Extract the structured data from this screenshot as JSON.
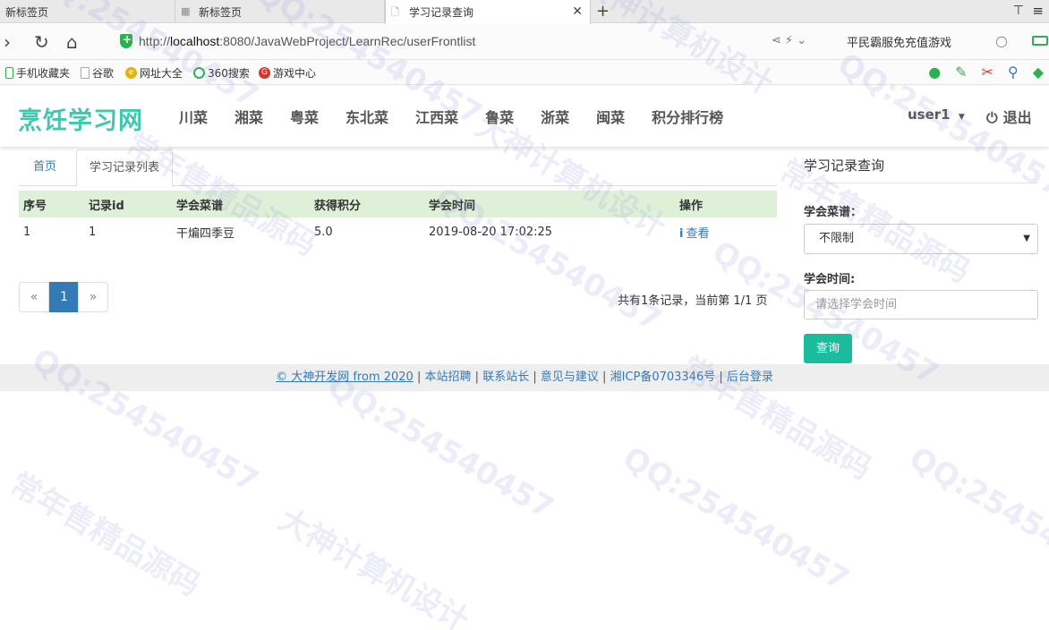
{
  "browser": {
    "tabs": [
      {
        "label": "新标签页"
      },
      {
        "label": "新标签页"
      },
      {
        "label": "学习记录查询"
      }
    ],
    "url_prefix": "http://",
    "url_host": "localhost",
    "url_rest": ":8080/JavaWebProject/LearnRec/userFrontlist",
    "promo": "平民霸服免充值游戏",
    "bookmarks": [
      "手机收藏夹",
      "谷歌",
      "网址大全",
      "360搜索",
      "游戏中心"
    ]
  },
  "site": {
    "logo": "烹饪学习网",
    "nav": [
      "川菜",
      "湘菜",
      "粤菜",
      "东北菜",
      "江西菜",
      "鲁菜",
      "浙菜",
      "闽菜",
      "积分排行榜"
    ],
    "user": "user1",
    "logout": "退出"
  },
  "content": {
    "tabs": {
      "home": "首页",
      "active": "学习记录列表"
    },
    "table": {
      "headers": [
        "序号",
        "记录id",
        "学会菜谱",
        "获得积分",
        "学会时间",
        "操作"
      ],
      "rows": [
        {
          "no": "1",
          "id": "1",
          "recipe": "干煸四季豆",
          "points": "5.0",
          "time": "2019-08-20 17:02:25",
          "action": "查看"
        }
      ]
    },
    "pager": {
      "prev": "«",
      "current": "1",
      "next": "»",
      "info": "共有1条记录，当前第 1/1 页"
    }
  },
  "side": {
    "title": "学习记录查询",
    "recipe_label": "学会菜谱：",
    "recipe_value": "不限制",
    "time_label": "学会时间:",
    "time_placeholder": "请选择学会时间",
    "query_button": "查询"
  },
  "footer": {
    "copyright": "© 大神开发网 from 2020",
    "links": [
      "本站招聘",
      "联系站长",
      "意见与建议",
      "湘ICP备0703346号",
      "后台登录"
    ]
  },
  "watermark": [
    "QQ:254540457",
    "常年售精品源码",
    "大神计算机设计"
  ]
}
